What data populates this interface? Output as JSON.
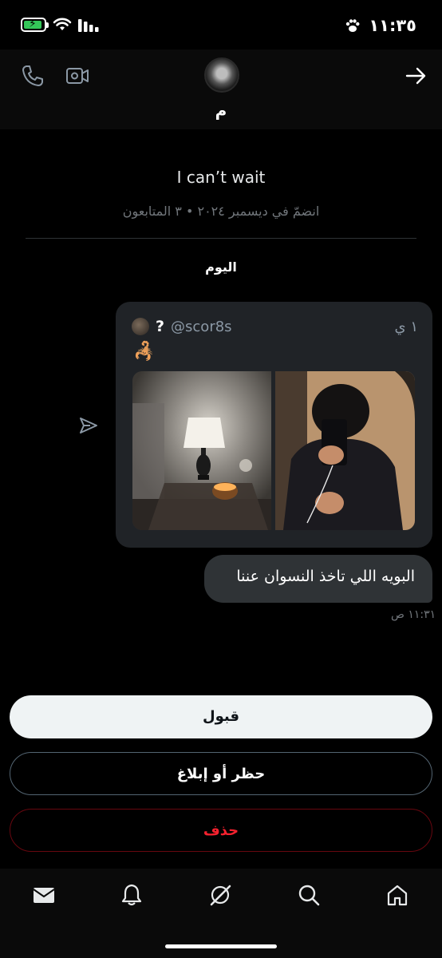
{
  "status_bar": {
    "time": "١١:٣٥"
  },
  "conversation": {
    "name": "م",
    "bio": "I can’t wait",
    "meta": "انضمّ في ديسمبر ٢٠٢٤ • ٣ المتابعون",
    "day_label": "اليوم"
  },
  "shared_post": {
    "author_name": "?",
    "handle": "@scor8s",
    "time": "١ ي",
    "emoji": "🦂"
  },
  "message": {
    "text": "البويه اللي تاخذ النسوان عننا",
    "time": "١١:٣١ ص"
  },
  "actions": {
    "accept": "قبول",
    "block_report": "حظر أو إبلاغ",
    "delete": "حذف"
  },
  "colors": {
    "background": "#000000",
    "bubble": "#2f3336",
    "card": "#202327",
    "accept_button": "#eff3f4",
    "delete_text": "#f4212e",
    "battery": "#34c759"
  },
  "icons": {
    "header": [
      "phone-icon",
      "video-icon",
      "back-arrow-icon"
    ],
    "nav": [
      "mail-icon",
      "bell-icon",
      "grok-icon",
      "search-icon",
      "home-icon"
    ]
  }
}
